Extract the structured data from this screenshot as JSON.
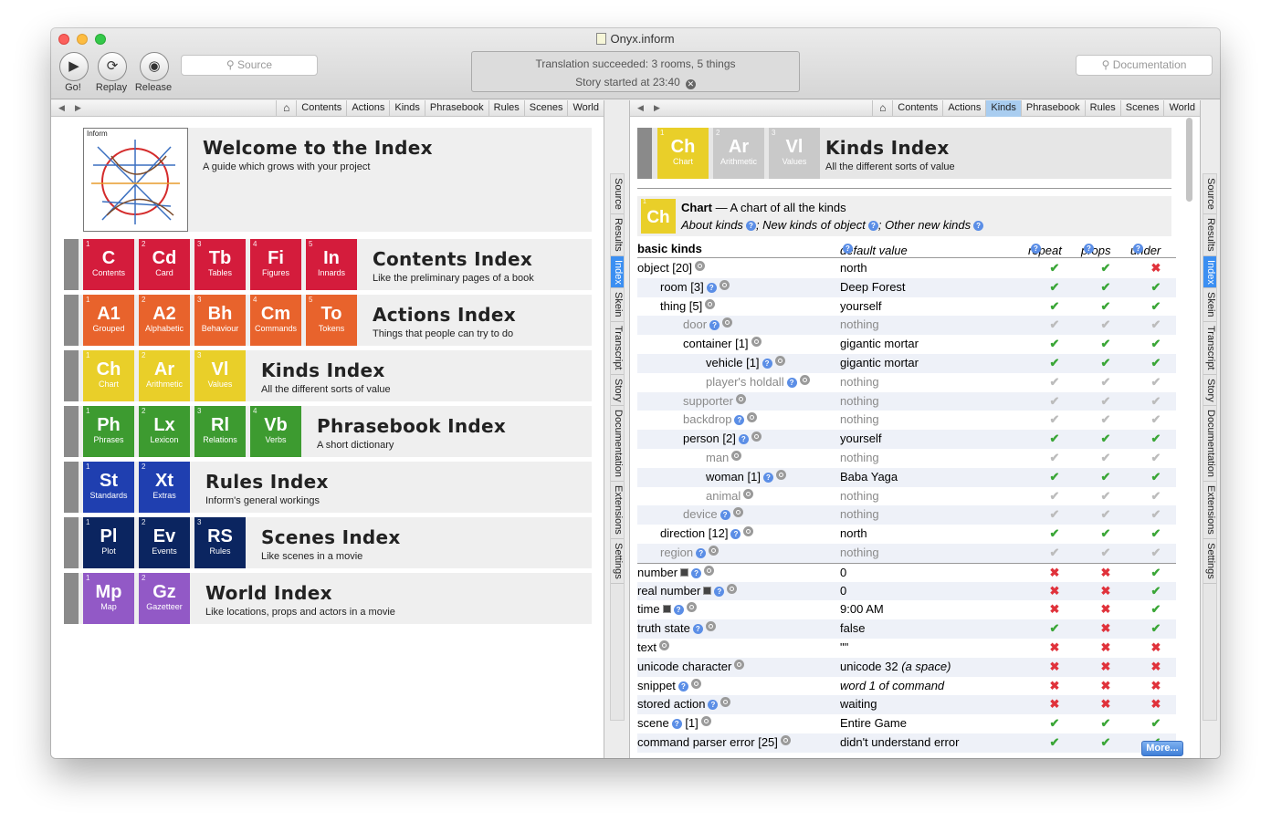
{
  "window": {
    "title": "Onyx.inform"
  },
  "toolbar": {
    "go": "Go!",
    "replay": "Replay",
    "release": "Release",
    "source_placeholder": "Source",
    "doc_placeholder": "Documentation",
    "status_line1": "Translation succeeded: 3 rooms, 5 things",
    "status_line2": "Story started at 23:40"
  },
  "nav_tabs": [
    "Contents",
    "Actions",
    "Kinds",
    "Phrasebook",
    "Rules",
    "Scenes",
    "World"
  ],
  "side_tabs": [
    "Source",
    "Results",
    "Index",
    "Skein",
    "Transcript",
    "Story",
    "Documentation",
    "Extensions",
    "Settings"
  ],
  "map_label": "Inform",
  "welcome": {
    "title": "Welcome to the Index",
    "subtitle": "A guide which grows with your project"
  },
  "index_rows": [
    {
      "title": "Contents Index",
      "subtitle": "Like the preliminary pages of a book",
      "color": "#d41c3c",
      "tiles": [
        [
          "1",
          "C",
          "Contents"
        ],
        [
          "2",
          "Cd",
          "Card"
        ],
        [
          "3",
          "Tb",
          "Tables"
        ],
        [
          "4",
          "Fi",
          "Figures"
        ],
        [
          "5",
          "In",
          "Innards"
        ]
      ]
    },
    {
      "title": "Actions Index",
      "subtitle": "Things that people can try to do",
      "color": "#e8632c",
      "tiles": [
        [
          "1",
          "A1",
          "Grouped"
        ],
        [
          "2",
          "A2",
          "Alphabetic"
        ],
        [
          "3",
          "Bh",
          "Behaviour"
        ],
        [
          "4",
          "Cm",
          "Commands"
        ],
        [
          "5",
          "To",
          "Tokens"
        ]
      ]
    },
    {
      "title": "Kinds Index",
      "subtitle": "All the different sorts of value",
      "color": "#e9cf29",
      "tiles": [
        [
          "1",
          "Ch",
          "Chart"
        ],
        [
          "2",
          "Ar",
          "Arithmetic"
        ],
        [
          "3",
          "Vl",
          "Values"
        ]
      ]
    },
    {
      "title": "Phrasebook Index",
      "subtitle": "A short dictionary",
      "color": "#3d9b30",
      "tiles": [
        [
          "1",
          "Ph",
          "Phrases"
        ],
        [
          "2",
          "Lx",
          "Lexicon"
        ],
        [
          "3",
          "Rl",
          "Relations"
        ],
        [
          "4",
          "Vb",
          "Verbs"
        ]
      ]
    },
    {
      "title": "Rules Index",
      "subtitle": "Inform's general workings",
      "color": "#1f3fb0",
      "tiles": [
        [
          "1",
          "St",
          "Standards"
        ],
        [
          "2",
          "Xt",
          "Extras"
        ]
      ]
    },
    {
      "title": "Scenes Index",
      "subtitle": "Like scenes in a movie",
      "color": "#0b2560",
      "tiles": [
        [
          "1",
          "Pl",
          "Plot"
        ],
        [
          "2",
          "Ev",
          "Events"
        ],
        [
          "3",
          "RS",
          "Rules"
        ]
      ]
    },
    {
      "title": "World Index",
      "subtitle": "Like locations, props and actors in a movie",
      "color": "#9259c6",
      "tiles": [
        [
          "1",
          "Mp",
          "Map"
        ],
        [
          "2",
          "Gz",
          "Gazetteer"
        ]
      ]
    }
  ],
  "kinds_header": {
    "title": "Kinds Index",
    "subtitle": "All the different sorts of value",
    "tiles": [
      [
        "1",
        "Ch",
        "Chart"
      ],
      [
        "2",
        "Ar",
        "Arithmetic"
      ],
      [
        "3",
        "Vl",
        "Values"
      ]
    ]
  },
  "chart_box": {
    "badge_num": "1",
    "badge": "Ch",
    "title": "Chart",
    "title_rest": " — A chart of all the kinds",
    "link1": "About kinds",
    "link2": "New kinds of object",
    "link3": "Other new kinds"
  },
  "table_header": {
    "name": "basic kinds",
    "default": "default value",
    "repeat": "repeat",
    "props": "props",
    "under": "under"
  },
  "rows": [
    {
      "name": "object [20]",
      "indent": 0,
      "dim": false,
      "q": false,
      "val": "north",
      "r": "g",
      "p": "g",
      "u": "x"
    },
    {
      "name": "room [3]",
      "indent": 1,
      "dim": false,
      "q": true,
      "val": "Deep Forest",
      "r": "g",
      "p": "g",
      "u": "g"
    },
    {
      "name": "thing [5]",
      "indent": 1,
      "dim": false,
      "q": false,
      "val": "yourself",
      "r": "g",
      "p": "g",
      "u": "g"
    },
    {
      "name": "door",
      "indent": 2,
      "dim": true,
      "q": true,
      "val": "nothing",
      "r": "d",
      "p": "d",
      "u": "d"
    },
    {
      "name": "container [1]",
      "indent": 2,
      "dim": false,
      "q": false,
      "val": "gigantic mortar",
      "r": "g",
      "p": "g",
      "u": "g"
    },
    {
      "name": "vehicle [1]",
      "indent": 3,
      "dim": false,
      "q": true,
      "val": "gigantic mortar",
      "r": "g",
      "p": "g",
      "u": "g"
    },
    {
      "name": "player's holdall",
      "indent": 3,
      "dim": true,
      "q": true,
      "val": "nothing",
      "r": "d",
      "p": "d",
      "u": "d"
    },
    {
      "name": "supporter",
      "indent": 2,
      "dim": true,
      "q": false,
      "val": "nothing",
      "r": "d",
      "p": "d",
      "u": "d"
    },
    {
      "name": "backdrop",
      "indent": 2,
      "dim": true,
      "q": true,
      "val": "nothing",
      "r": "d",
      "p": "d",
      "u": "d"
    },
    {
      "name": "person [2]",
      "indent": 2,
      "dim": false,
      "q": true,
      "val": "yourself",
      "r": "g",
      "p": "g",
      "u": "g"
    },
    {
      "name": "man",
      "indent": 3,
      "dim": true,
      "q": false,
      "val": "nothing",
      "r": "d",
      "p": "d",
      "u": "d"
    },
    {
      "name": "woman [1]",
      "indent": 3,
      "dim": false,
      "q": true,
      "val": "Baba Yaga",
      "r": "g",
      "p": "g",
      "u": "g"
    },
    {
      "name": "animal",
      "indent": 3,
      "dim": true,
      "q": false,
      "val": "nothing",
      "r": "d",
      "p": "d",
      "u": "d"
    },
    {
      "name": "device",
      "indent": 2,
      "dim": true,
      "q": true,
      "val": "nothing",
      "r": "d",
      "p": "d",
      "u": "d"
    },
    {
      "name": "direction [12]",
      "indent": 1,
      "dim": false,
      "q": true,
      "val": "north",
      "r": "g",
      "p": "g",
      "u": "g"
    },
    {
      "name": "region",
      "indent": 1,
      "dim": true,
      "q": true,
      "val": "nothing",
      "r": "d",
      "p": "d",
      "u": "d"
    },
    {
      "name": "number",
      "indent": 0,
      "dim": false,
      "q": true,
      "sq": true,
      "top": true,
      "val": "0",
      "r": "x",
      "p": "x",
      "u": "g"
    },
    {
      "name": "real number",
      "indent": 0,
      "dim": false,
      "q": true,
      "sq": true,
      "val": "0",
      "r": "x",
      "p": "x",
      "u": "g"
    },
    {
      "name": "time",
      "indent": 0,
      "dim": false,
      "q": true,
      "sq": true,
      "val": "9:00 AM",
      "r": "x",
      "p": "x",
      "u": "g"
    },
    {
      "name": "truth state",
      "indent": 0,
      "dim": false,
      "q": true,
      "val": "false",
      "r": "g",
      "p": "x",
      "u": "g"
    },
    {
      "name": "text",
      "indent": 0,
      "dim": false,
      "q": false,
      "val": "\"\"",
      "r": "x",
      "p": "x",
      "u": "x"
    },
    {
      "name": "unicode character",
      "indent": 0,
      "dim": false,
      "q": false,
      "val": "unicode 32 ",
      "val_extra": "(a space)",
      "r": "x",
      "p": "x",
      "u": "x"
    },
    {
      "name": "snippet",
      "indent": 0,
      "dim": false,
      "q": true,
      "val": "word 1 of command",
      "ital": true,
      "r": "x",
      "p": "x",
      "u": "x"
    },
    {
      "name": "stored action",
      "indent": 0,
      "dim": false,
      "q": true,
      "val": "waiting",
      "r": "x",
      "p": "x",
      "u": "x"
    },
    {
      "name": "scene",
      "indent": 0,
      "dim": false,
      "q": true,
      "suffix": " [1]",
      "val": "Entire Game",
      "r": "g",
      "p": "g",
      "u": "g"
    },
    {
      "name": "command parser error [25]",
      "indent": 0,
      "dim": false,
      "q": false,
      "val": "didn't understand error",
      "r": "g",
      "p": "g",
      "u": "g"
    }
  ],
  "more_button": "More..."
}
